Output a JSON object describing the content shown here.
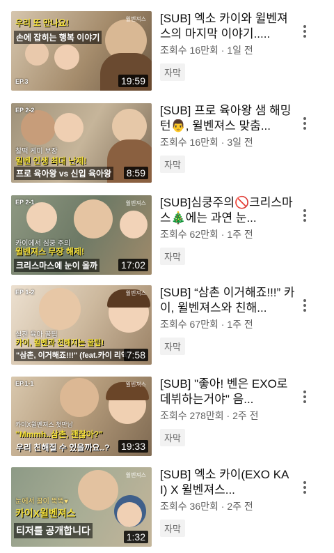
{
  "videos": [
    {
      "title": "[SUB] 엑소 카이와 윌벤져스의 마지막 이야기.....",
      "views": "조회수 16만회",
      "age": "1일 전",
      "badge": "자막",
      "duration": "19:59",
      "thumb": {
        "ep": "EP.3",
        "cap1": "",
        "cap2": "우리 또 만나요!",
        "cap3": "손에 잡히는 행복 이야기",
        "bg": "#b9a58a"
      }
    },
    {
      "title": "[SUB] 프로 육아왕 샘 해밍턴👨, 윌벤져스 맞춤...",
      "views": "조회수 16만회",
      "age": "3일 전",
      "badge": "자막",
      "duration": "8:59",
      "thumb": {
        "ep": "EP 2-2",
        "cap1": "찰떡 케미 보장",
        "cap2": "윌벤 인생 최대 난제!",
        "cap3": "프로 육아왕 vs 신입 육아왕",
        "bg": "#a89a80"
      }
    },
    {
      "title": "[SUB]심쿵주의🚫크리스마스🎄에는 과연 눈...",
      "views": "조회수 62만회",
      "age": "1주 전",
      "badge": "자막",
      "duration": "17:02",
      "thumb": {
        "ep": "EP 2-1",
        "cap1": "카이에서 심쿵 주의",
        "cap2": "윌벤져스 무장 해제!",
        "cap3": "크리스마스에 눈이 올까",
        "bg": "#7f8a76"
      }
    },
    {
      "title": "[SUB] “삼촌 이거해죠!!!” 카이, 윌벤져스와 친해...",
      "views": "조회수 67만회",
      "age": "1주 전",
      "badge": "자막",
      "duration": "7:58",
      "thumb": {
        "ep": "EP 1-2",
        "cap1": "실전 육아 꿀팁",
        "cap2": "카이, 윌벤과 친해지는 꿀팁!",
        "cap3": "\"삼촌, 이거해죠!!!\" (feat.카이 리액",
        "bg": "#c9b7a0"
      }
    },
    {
      "title": "[SUB] \"좋아! 벤은 EXO로 데뷔하는거야\" 음...",
      "views": "조회수 278만회",
      "age": "2주 전",
      "badge": "자막",
      "duration": "19:33",
      "thumb": {
        "ep": "EP.1-1",
        "cap1": "카이X윌벤져스 첫만남",
        "cap2": "\"Mmmh..삼촌, 괜찮아?\"",
        "cap3": "우리 친해질 수 있을까요..?",
        "bg": "#b8a68c"
      }
    },
    {
      "title": "[SUB] 엑소 카이(EXO KAI) X 윌벤져스...",
      "views": "조회수 36만회",
      "age": "2주 전",
      "badge": "자막",
      "duration": "1:32",
      "thumb": {
        "ep": "",
        "cap1": "눈에서 꿀이 뚝뚝♥",
        "cap2": "카이X윌벤져스",
        "cap3": "티저를 공개합니다",
        "bg": "#9aa08c"
      }
    }
  ],
  "separator": " · "
}
